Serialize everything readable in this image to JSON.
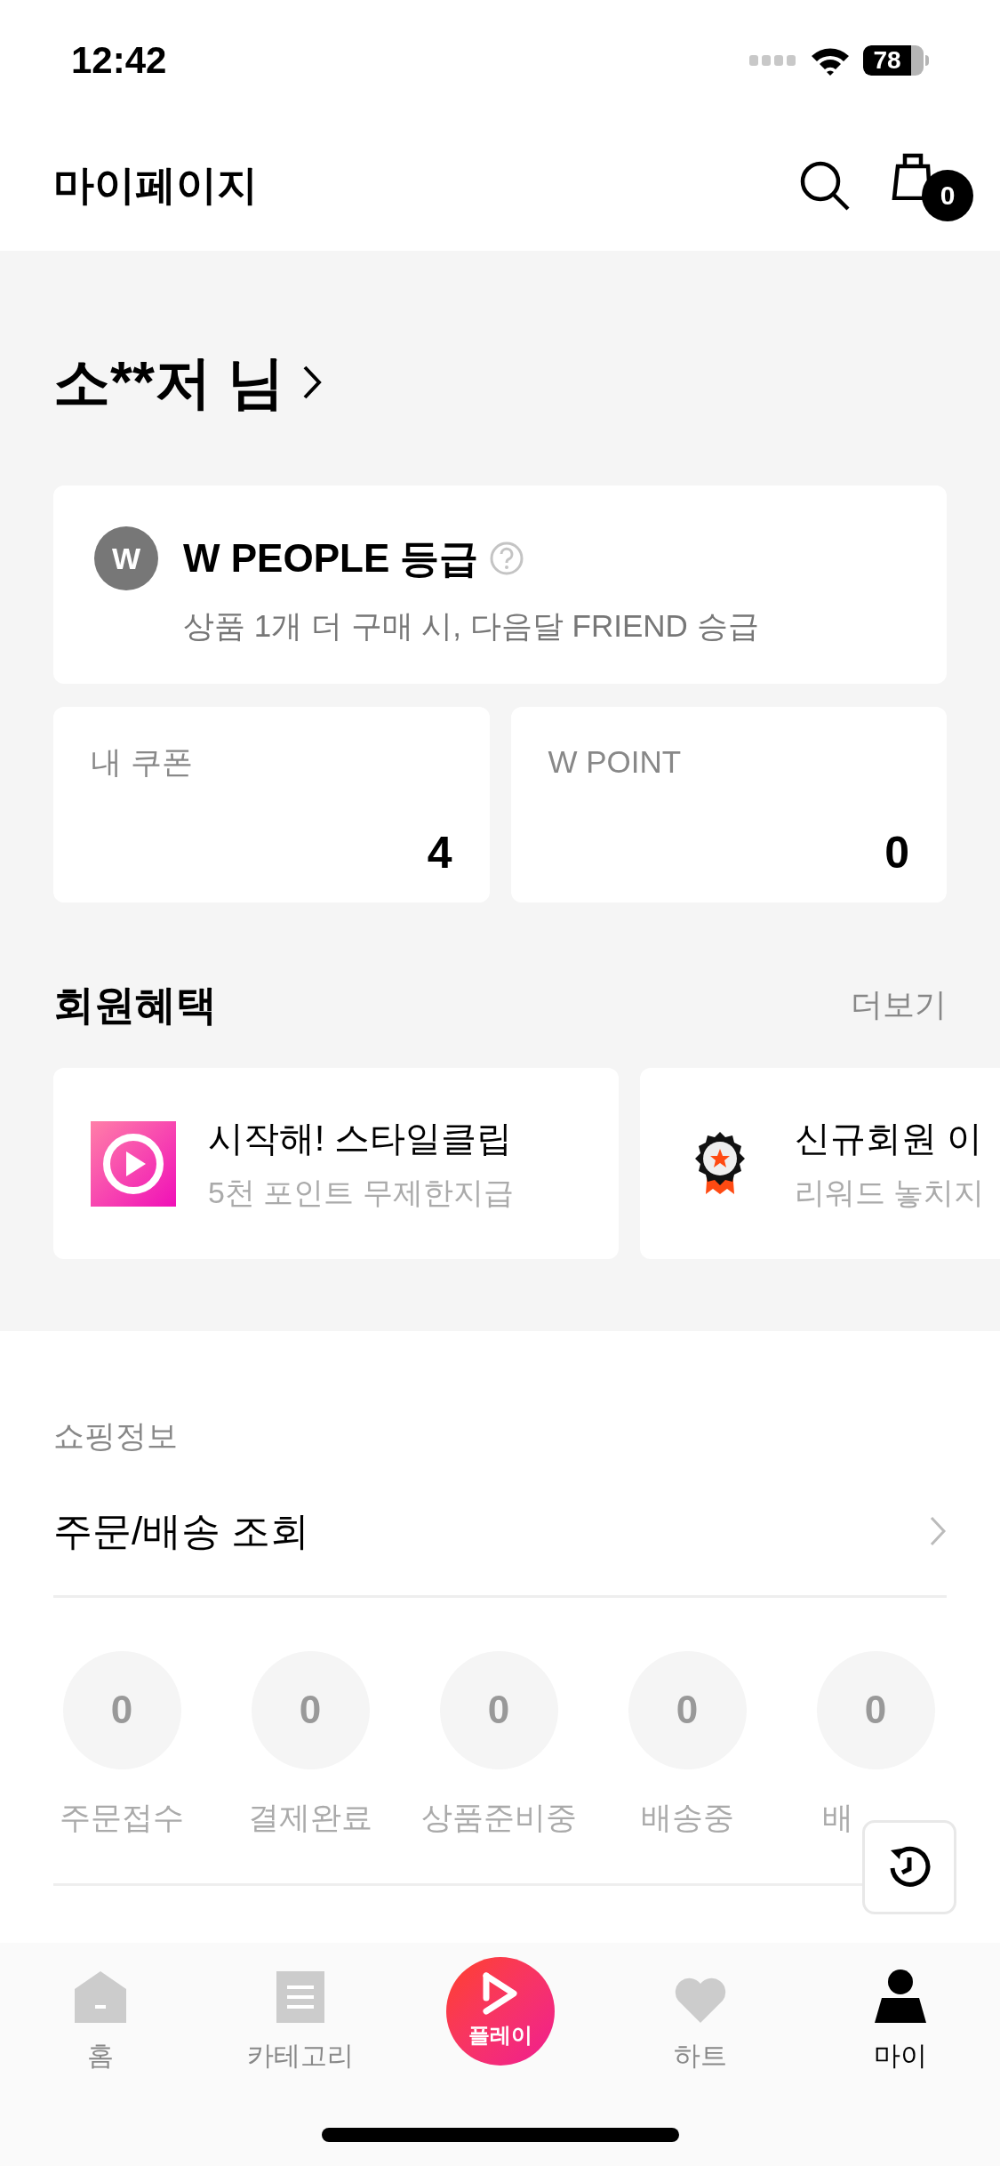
{
  "status_bar": {
    "time": "12:42",
    "battery": "78"
  },
  "header": {
    "title": "마이페이지",
    "cart_count": "0"
  },
  "profile": {
    "name": "소**저 님"
  },
  "grade": {
    "badge": "W",
    "title": "W PEOPLE 등급",
    "note": "상품 1개 더 구매 시, 다음달 FRIEND 승급"
  },
  "wallet": [
    {
      "label": "내 쿠폰",
      "value": "4"
    },
    {
      "label": "W POINT",
      "value": "0"
    }
  ],
  "benefits": {
    "title": "회원혜택",
    "more": "더보기",
    "items": [
      {
        "kind": "play",
        "title": "시작해! 스타일클립",
        "subtitle": "5천 포인트 무제한지급"
      },
      {
        "kind": "award",
        "title": "신규회원 이",
        "subtitle": "리워드 놓치지"
      }
    ]
  },
  "shopping": {
    "section": "쇼핑정보",
    "link": "주문/배송 조회",
    "statuses": [
      {
        "count": "0",
        "label": "주문접수"
      },
      {
        "count": "0",
        "label": "결제완료"
      },
      {
        "count": "0",
        "label": "상품준비중"
      },
      {
        "count": "0",
        "label": "배송중"
      },
      {
        "count": "0",
        "label": "배"
      }
    ]
  },
  "nav": [
    {
      "kind": "home",
      "label": "홈",
      "selected": false
    },
    {
      "kind": "category",
      "label": "카테고리",
      "selected": false
    },
    {
      "kind": "play",
      "label": "플레이",
      "selected": false
    },
    {
      "kind": "heart",
      "label": "하트",
      "selected": false
    },
    {
      "kind": "person",
      "label": "마이",
      "selected": true
    }
  ]
}
